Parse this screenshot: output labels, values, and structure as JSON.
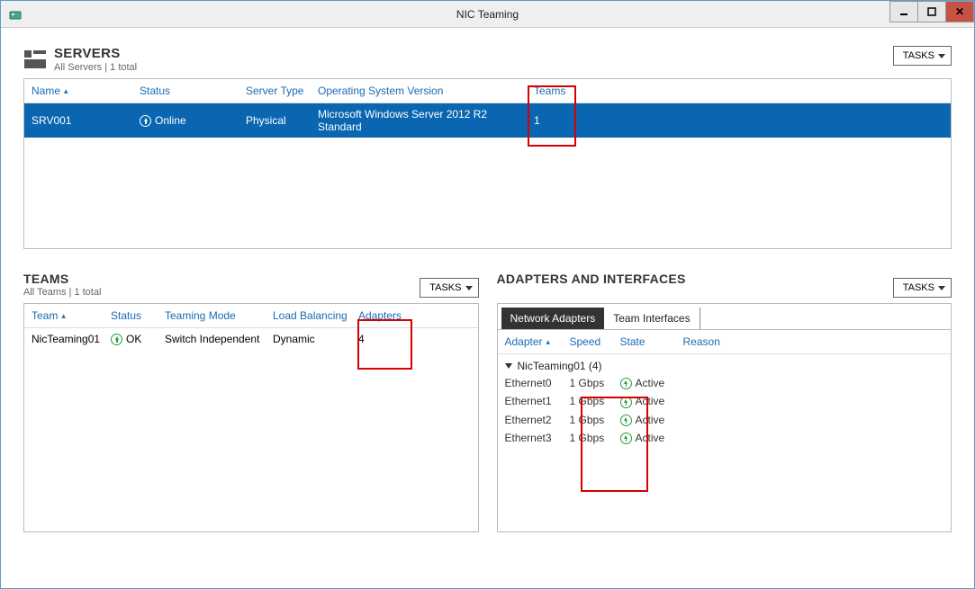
{
  "window": {
    "title": "NIC Teaming"
  },
  "tasks_label": "TASKS",
  "servers": {
    "title": "SERVERS",
    "subtitle": "All Servers | 1 total",
    "columns": {
      "name": "Name",
      "status": "Status",
      "type": "Server Type",
      "os": "Operating System Version",
      "teams": "Teams"
    },
    "row": {
      "name": "SRV001",
      "status": "Online",
      "type": "Physical",
      "os": "Microsoft Windows Server 2012 R2 Standard",
      "teams": "1"
    }
  },
  "teams": {
    "title": "TEAMS",
    "subtitle": "All Teams | 1 total",
    "columns": {
      "team": "Team",
      "status": "Status",
      "mode": "Teaming Mode",
      "lb": "Load Balancing",
      "adapters": "Adapters"
    },
    "row": {
      "team": "NicTeaming01",
      "status": "OK",
      "mode": "Switch Independent",
      "lb": "Dynamic",
      "adapters": "4"
    }
  },
  "ai": {
    "title": "ADAPTERS AND INTERFACES",
    "tabs": {
      "net": "Network Adapters",
      "ti": "Team Interfaces"
    },
    "columns": {
      "adapter": "Adapter",
      "speed": "Speed",
      "state": "State",
      "reason": "Reason"
    },
    "group": "NicTeaming01 (4)",
    "rows": [
      {
        "adapter": "Ethernet0",
        "speed": "1 Gbps",
        "state": "Active"
      },
      {
        "adapter": "Ethernet1",
        "speed": "1 Gbps",
        "state": "Active"
      },
      {
        "adapter": "Ethernet2",
        "speed": "1 Gbps",
        "state": "Active"
      },
      {
        "adapter": "Ethernet3",
        "speed": "1 Gbps",
        "state": "Active"
      }
    ]
  }
}
